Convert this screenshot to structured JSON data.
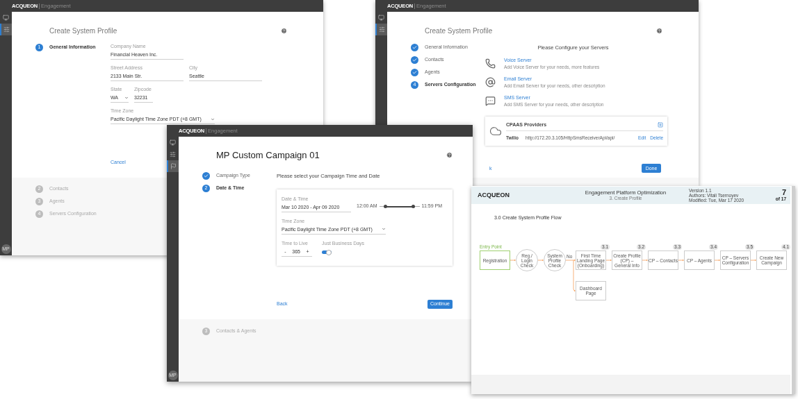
{
  "profile_window": {
    "brand": "ACQUEON",
    "product": "Engagement",
    "avatar": "MP",
    "title": "Create System Profile",
    "sidebar": [
      {
        "selected": false
      },
      {
        "selected": true
      }
    ],
    "steps": [
      {
        "kind": "step",
        "number": "1",
        "label": "General Information",
        "selected": true
      },
      {
        "kind": "step",
        "number": "2",
        "label": "Contacts",
        "selected": false
      },
      {
        "kind": "step",
        "number": "3",
        "label": "Agents",
        "selected": false
      },
      {
        "kind": "step",
        "number": "4",
        "label": "Servers Configuration",
        "selected": false
      }
    ],
    "field_rows": [
      [
        {
          "label": "Company Name",
          "value": "Financial Heaven Inc.",
          "kind": "text"
        }
      ],
      [
        {
          "label": "Street Address",
          "value": "2133 Main Str.",
          "kind": "text"
        },
        {
          "label": "City",
          "value": "Seattle",
          "kind": "text"
        }
      ],
      [
        {
          "label": "State",
          "value": "WA",
          "kind": "select"
        },
        {
          "label": "Zipcode",
          "value": "32231",
          "kind": "text"
        }
      ],
      [
        {
          "label": "Time Zone",
          "value": "Pacific Daylight Time Zone PDT (+8 GMT)",
          "kind": "select"
        }
      ]
    ],
    "cancel": "Cancel"
  },
  "servers_window": {
    "brand": "ACQUEON",
    "product": "Engagement",
    "title": "Create System Profile",
    "sidebar": [
      {
        "selected": false
      },
      {
        "selected": true
      }
    ],
    "steps": [
      {
        "kind": "done",
        "label": "General Information",
        "selected": false
      },
      {
        "kind": "done",
        "label": "Contacts",
        "selected": false
      },
      {
        "kind": "done",
        "label": "Agents",
        "selected": false
      },
      {
        "kind": "step",
        "number": "4",
        "label": "Servers Configuration",
        "selected": true
      }
    ],
    "heading": "Please Configure your Servers",
    "servers": [
      {
        "name": "Voice Server",
        "description": "Add Voice Server for your needs, more features"
      },
      {
        "name": "Email Server",
        "description": "Add Email Server for your needs, other description"
      },
      {
        "name": "SMS Server",
        "description": "Add SMS Server for your needs, other description"
      }
    ],
    "cpaas": {
      "title": "CPAAS Providers",
      "providers": [
        {
          "name": "Twilio",
          "url": "http://172.20.3.105/HttpSmsReceiverApi/api/",
          "edit": "Edit",
          "delete": "Delete"
        }
      ]
    },
    "back": "k",
    "done": "Done"
  },
  "campaign_window": {
    "brand": "ACQUEON",
    "product": "Engagement",
    "avatar": "MP",
    "title": "MP Custom Campaign 01",
    "sidebar": [
      {
        "selected": false
      },
      {
        "selected": false
      },
      {
        "selected": true
      }
    ],
    "steps": [
      {
        "kind": "done",
        "label": "Campaign Type",
        "selected": false
      },
      {
        "kind": "step",
        "number": "2",
        "label": "Date & Time",
        "selected": true
      },
      {
        "kind": "step",
        "number": "3",
        "label": "Contacts & Agents",
        "selected": false
      }
    ],
    "heading": "Please select your Campaign Time and Date",
    "date_label": "Date & Time",
    "date_value": "Mar 10 2020 - Apr 09 2020",
    "time_start": "12:00 AM",
    "time_end": "11:59 PM",
    "time_thumbs": [
      {
        "level": 0.16
      },
      {
        "level": 0.84
      }
    ],
    "timezone_label": "Time Zone",
    "timezone_value": "Pacific Daylight Time Zone PDT (+8 GMT)",
    "ttl_label": "Time to Live",
    "ttl_minus": "-",
    "ttl_value": "365",
    "ttl_plus": "+",
    "business_label": "Just Business Days",
    "business_on": true,
    "back": "Back",
    "continue": "Continue"
  },
  "document_window": {
    "brand": "ACQUEON",
    "title": "Engagement Platform Optimization",
    "subtitle": "3. Create Profile",
    "meta": [
      "Version 1.1",
      "Authors: Vitali Tsernoyev",
      "Modified: Tue, Mar 17 2020"
    ],
    "page": "7",
    "page_of": "of 17",
    "section": "3.0 Create System Profile Flow",
    "entry_label": "Entry Point",
    "branch_label": "No",
    "nodes": [
      {
        "kind": "start",
        "label": "Registration"
      },
      {
        "kind": "decision",
        "label": "Reg./ Login Check"
      },
      {
        "kind": "decision",
        "label": "System Profile Check"
      },
      {
        "kind": "step",
        "label": "First Time Landing Page (Onboarding)",
        "badge": "3.1"
      },
      {
        "kind": "step",
        "label": "Create Profile (CP) – General Info",
        "badge": "3.2"
      },
      {
        "kind": "step",
        "label": "CP – Contacts",
        "badge": "3.3"
      },
      {
        "kind": "step",
        "label": "CP – Agents",
        "badge": "3.4"
      },
      {
        "kind": "step",
        "label": "CP – Servers Configuration",
        "badge": "3.5"
      },
      {
        "kind": "step",
        "label": "Create New Campaign",
        "badge": "4.1"
      }
    ],
    "side_node": {
      "label": "Dashboard Page"
    }
  }
}
